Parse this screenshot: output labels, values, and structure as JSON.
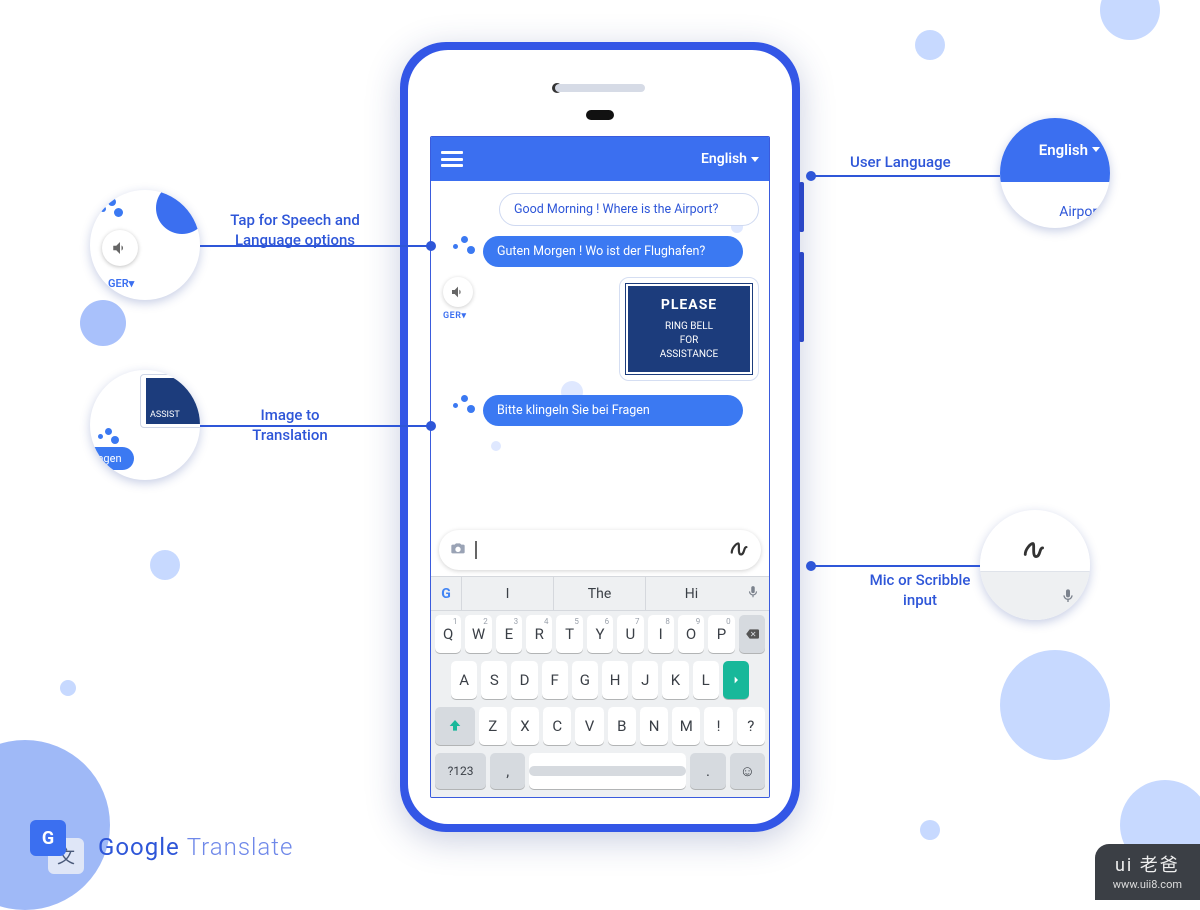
{
  "appbar": {
    "language": "English"
  },
  "chat": {
    "msg_in_1": "Good Morning ! Where is the Airport?",
    "msg_tr_1": "Guten Morgen ! Wo ist der Flughafen?",
    "lang_tag": "GER",
    "sign_please": "PLEASE",
    "sign_line1": "RING BELL",
    "sign_line2": "FOR",
    "sign_line3": "ASSISTANCE",
    "msg_tr_2": "Bitte klingeln Sie bei Fragen"
  },
  "keyboard": {
    "g": "G",
    "sug1": "I",
    "sug2": "The",
    "sug3": "Hi",
    "row1": [
      "Q",
      "W",
      "E",
      "R",
      "T",
      "Y",
      "U",
      "I",
      "O",
      "P"
    ],
    "nums": [
      "1",
      "2",
      "3",
      "4",
      "5",
      "6",
      "7",
      "8",
      "9",
      "0"
    ],
    "row2": [
      "A",
      "S",
      "D",
      "F",
      "G",
      "H",
      "J",
      "K",
      "L"
    ],
    "row3": [
      "Z",
      "X",
      "C",
      "V",
      "B",
      "N",
      "M",
      "!",
      "?"
    ],
    "sym": "?123",
    "comma": ",",
    "dot": "."
  },
  "callouts": {
    "user_language": "User Language",
    "speech": "Tap for Speech and Language options",
    "image": "Image to Translation",
    "scribble": "Mic or Scribble input",
    "zoom_lang_label": "English",
    "zoom_lang_sub": "Airport",
    "zoom_ger": "GER",
    "zoom_assist": "ASSIST",
    "zoom_fragen": "Fragen"
  },
  "footer": {
    "brand": "Google",
    "product": "Translate"
  },
  "watermark": {
    "brand": "ui 老爸",
    "url": "www.uii8.com"
  }
}
